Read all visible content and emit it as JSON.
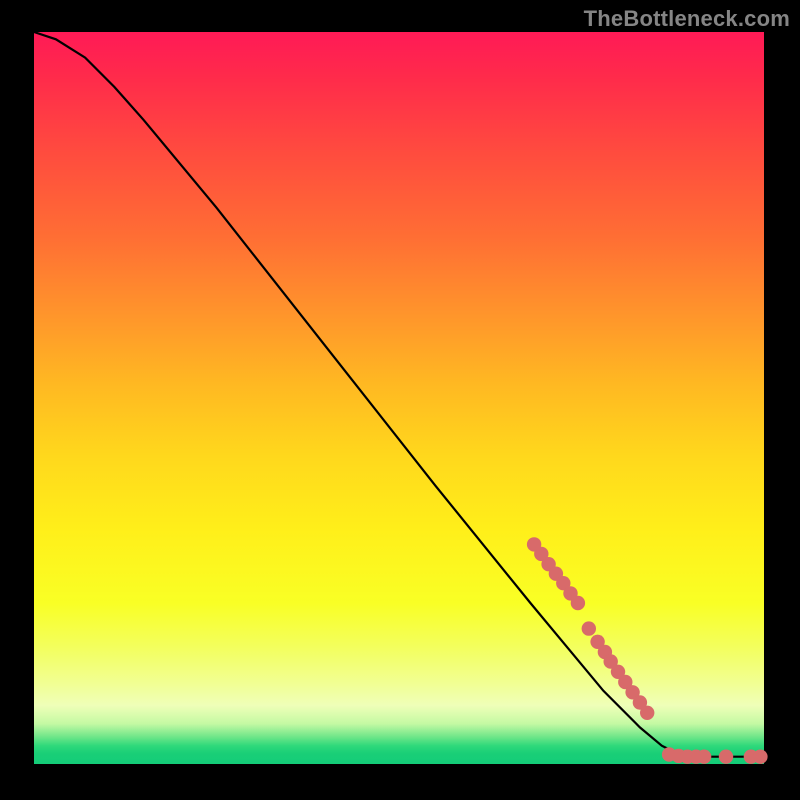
{
  "watermark_text": "TheBottleneck.com",
  "chart_data": {
    "type": "line",
    "title": "",
    "xlabel": "",
    "ylabel": "",
    "x_range": [
      0,
      100
    ],
    "y_range": [
      0,
      100
    ],
    "grid": false,
    "legend": false,
    "series": [
      {
        "name": "curve",
        "kind": "line",
        "color": "#000000",
        "points": [
          {
            "x": 0.0,
            "y": 100.0
          },
          {
            "x": 3.0,
            "y": 99.0
          },
          {
            "x": 7.0,
            "y": 96.5
          },
          {
            "x": 11.0,
            "y": 92.5
          },
          {
            "x": 15.0,
            "y": 88.0
          },
          {
            "x": 25.0,
            "y": 76.0
          },
          {
            "x": 40.0,
            "y": 57.0
          },
          {
            "x": 55.0,
            "y": 38.0
          },
          {
            "x": 68.0,
            "y": 22.0
          },
          {
            "x": 78.0,
            "y": 10.0
          },
          {
            "x": 83.0,
            "y": 5.0
          },
          {
            "x": 86.0,
            "y": 2.5
          },
          {
            "x": 88.0,
            "y": 1.5
          },
          {
            "x": 92.0,
            "y": 1.0
          },
          {
            "x": 100.0,
            "y": 1.0
          }
        ]
      },
      {
        "name": "markers",
        "kind": "scatter",
        "color": "#d86a6a",
        "points": [
          {
            "x": 68.5,
            "y": 30.0
          },
          {
            "x": 69.5,
            "y": 28.7
          },
          {
            "x": 70.5,
            "y": 27.3
          },
          {
            "x": 71.5,
            "y": 26.0
          },
          {
            "x": 72.5,
            "y": 24.7
          },
          {
            "x": 73.5,
            "y": 23.3
          },
          {
            "x": 74.5,
            "y": 22.0
          },
          {
            "x": 76.0,
            "y": 18.5
          },
          {
            "x": 77.2,
            "y": 16.7
          },
          {
            "x": 78.2,
            "y": 15.3
          },
          {
            "x": 79.0,
            "y": 14.0
          },
          {
            "x": 80.0,
            "y": 12.6
          },
          {
            "x": 81.0,
            "y": 11.2
          },
          {
            "x": 82.0,
            "y": 9.8
          },
          {
            "x": 83.0,
            "y": 8.4
          },
          {
            "x": 84.0,
            "y": 7.0
          },
          {
            "x": 87.0,
            "y": 1.3
          },
          {
            "x": 88.3,
            "y": 1.1
          },
          {
            "x": 89.5,
            "y": 1.0
          },
          {
            "x": 90.7,
            "y": 1.0
          },
          {
            "x": 91.8,
            "y": 1.0
          },
          {
            "x": 94.8,
            "y": 1.0
          },
          {
            "x": 98.2,
            "y": 1.0
          },
          {
            "x": 99.5,
            "y": 1.0
          }
        ]
      }
    ]
  }
}
